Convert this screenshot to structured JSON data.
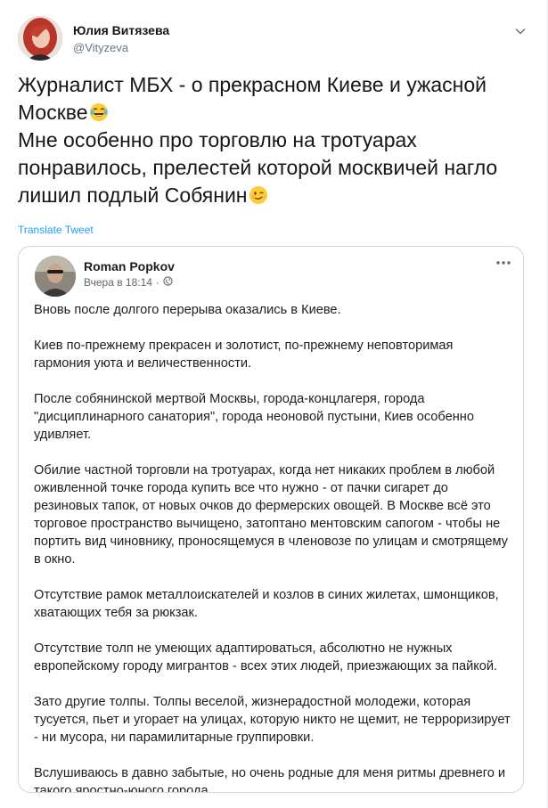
{
  "tweet": {
    "author": {
      "name": "Юлия Витязева",
      "handle": "@Vityzeva"
    },
    "text_lines": [
      "Журналист МБХ - о прекрасном Киеве и ужасной",
      "Москве",
      "Мне особенно про торговлю на тротуарах",
      "понравилось, прелестей которой москвичей нагло",
      "лишил подлый Собянин"
    ],
    "emojis": {
      "after_line_2": "laughing-tears-emoji",
      "after_line_5": "winking-face-emoji"
    },
    "translate_label": "Translate Tweet"
  },
  "quoted_post": {
    "author": {
      "name": "Roman Popkov"
    },
    "time": "Вчера в 18:14",
    "separator": "·",
    "icons": {
      "visibility": "globe-icon",
      "menu": "more-horizontal-icon",
      "header_caret": "chevron-down-icon"
    },
    "paragraphs": [
      "Вновь после долгого перерыва оказались в Киеве.",
      "Киев по-прежнему прекрасен и золотист, по-прежнему неповторимая гармония уюта и величественности.",
      "После собянинской мертвой Москвы, города-концлагеря, города \"дисциплинарного санатория\", города неоновой пустыни, Киев особенно удивляет.",
      "Обилие частной торговли на тротуарах, когда нет никаких проблем в любой оживленной точке города купить все что нужно - от пачки сигарет до резиновых тапок, от новых очков до фермерских овощей. В Москве всё это торговое пространство вычищено, затоптано ментовским сапогом - чтобы не портить вид чиновнику, проносящемуся в членовозе по улицам и смотрящему в окно.",
      "Отсутствие рамок металлоискателей и козлов в синих жилетах, шмонщиков, хватающих тебя за рюкзак.",
      "Отсутствие толп не умеющих адаптироваться, абсолютно не нужных европейскому городу мигрантов - всех этих людей, приезжающих за пайкой.",
      "Зато другие толпы. Толпы веселой, жизнерадостной молодежи, которая тусуется, пьет и угорает на улицах, которую никто не щемит, не терроризирует - ни мусора, ни парамилитарные группировки.",
      "Вслушиваюсь в давно забытые, но очень родные для меня ритмы древнего и такого яростно-юного города."
    ]
  },
  "colors": {
    "link_blue": "#1da1f2",
    "text_primary": "#14171a",
    "text_secondary": "#657786",
    "border": "#ccd6dd"
  }
}
